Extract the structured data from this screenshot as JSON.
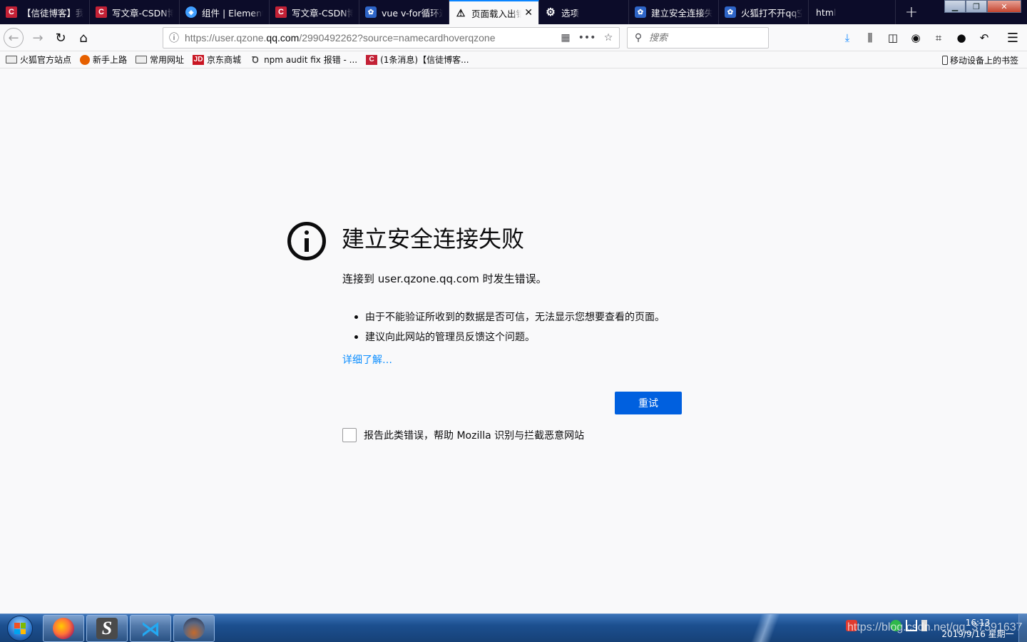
{
  "tabs": [
    {
      "icon": "csdn-icon",
      "glyph": "C",
      "label": "【信徒博客】我",
      "active": false
    },
    {
      "icon": "csdn-icon",
      "glyph": "C",
      "label": "写文章-CSDN博",
      "active": false
    },
    {
      "icon": "element-icon",
      "glyph": "◈",
      "label": "组件 | Element",
      "active": false
    },
    {
      "icon": "csdn-icon",
      "glyph": "C",
      "label": "写文章-CSDN博",
      "active": false
    },
    {
      "icon": "baidu-paw-icon",
      "glyph": "✿",
      "label": "vue v-for循环遍",
      "active": false
    },
    {
      "icon": "warning-icon",
      "glyph": "⚠",
      "label": "页面载入出错",
      "active": true
    },
    {
      "icon": "gear-icon",
      "glyph": "⚙",
      "label": "选项",
      "active": false
    },
    {
      "icon": "baidu-paw-icon",
      "glyph": "✿",
      "label": "建立安全连接失",
      "active": false
    },
    {
      "icon": "baidu-paw-icon",
      "glyph": "✿",
      "label": "火狐打不开qq空",
      "active": false
    },
    {
      "icon": "",
      "glyph": "",
      "label": "html",
      "active": false
    }
  ],
  "urlbar": {
    "prefix": "https://user.qzone.",
    "domain": "qq.com",
    "suffix": "/2990492262?source=namecardhoverqzone"
  },
  "search": {
    "placeholder": "搜索"
  },
  "bookmarks": [
    {
      "icon": "folder-icon",
      "label": "火狐官方站点"
    },
    {
      "icon": "firefox-icon",
      "label": "新手上路"
    },
    {
      "icon": "folder-icon",
      "label": "常用网址"
    },
    {
      "icon": "jd-icon",
      "glyph": "JD",
      "label": "京东商城"
    },
    {
      "icon": "npm-icon",
      "glyph": "Ꝺ",
      "label": "npm audit fix 报错 - ..."
    },
    {
      "icon": "csdn-icon",
      "glyph": "C",
      "label": "(1条消息)【信徒博客..."
    }
  ],
  "mobile_bookmarks": "移动设备上的书签",
  "error": {
    "title": "建立安全连接失败",
    "description": "连接到 user.qzone.qq.com 时发生错误。",
    "bullets": [
      "由于不能验证所收到的数据是否可信，无法显示您想要查看的页面。",
      "建议向此网站的管理员反馈这个问题。"
    ],
    "learn_more": "详细了解…",
    "retry_label": "重试",
    "report_label": "报告此类错误，帮助 Mozilla 识别与拦截恶意网站"
  },
  "taskbar": {
    "apps": [
      "firefox-icon",
      "sublime-text-icon",
      "vscode-icon",
      "photo-app-icon"
    ],
    "time": "16:13",
    "date": "2019/9/16 星期一",
    "watermark": "https://blog.csdn.net/qq_37591637"
  },
  "colors": {
    "tabstrip": "#0c0c29",
    "accent": "#0060df",
    "link": "#0a8dff"
  }
}
